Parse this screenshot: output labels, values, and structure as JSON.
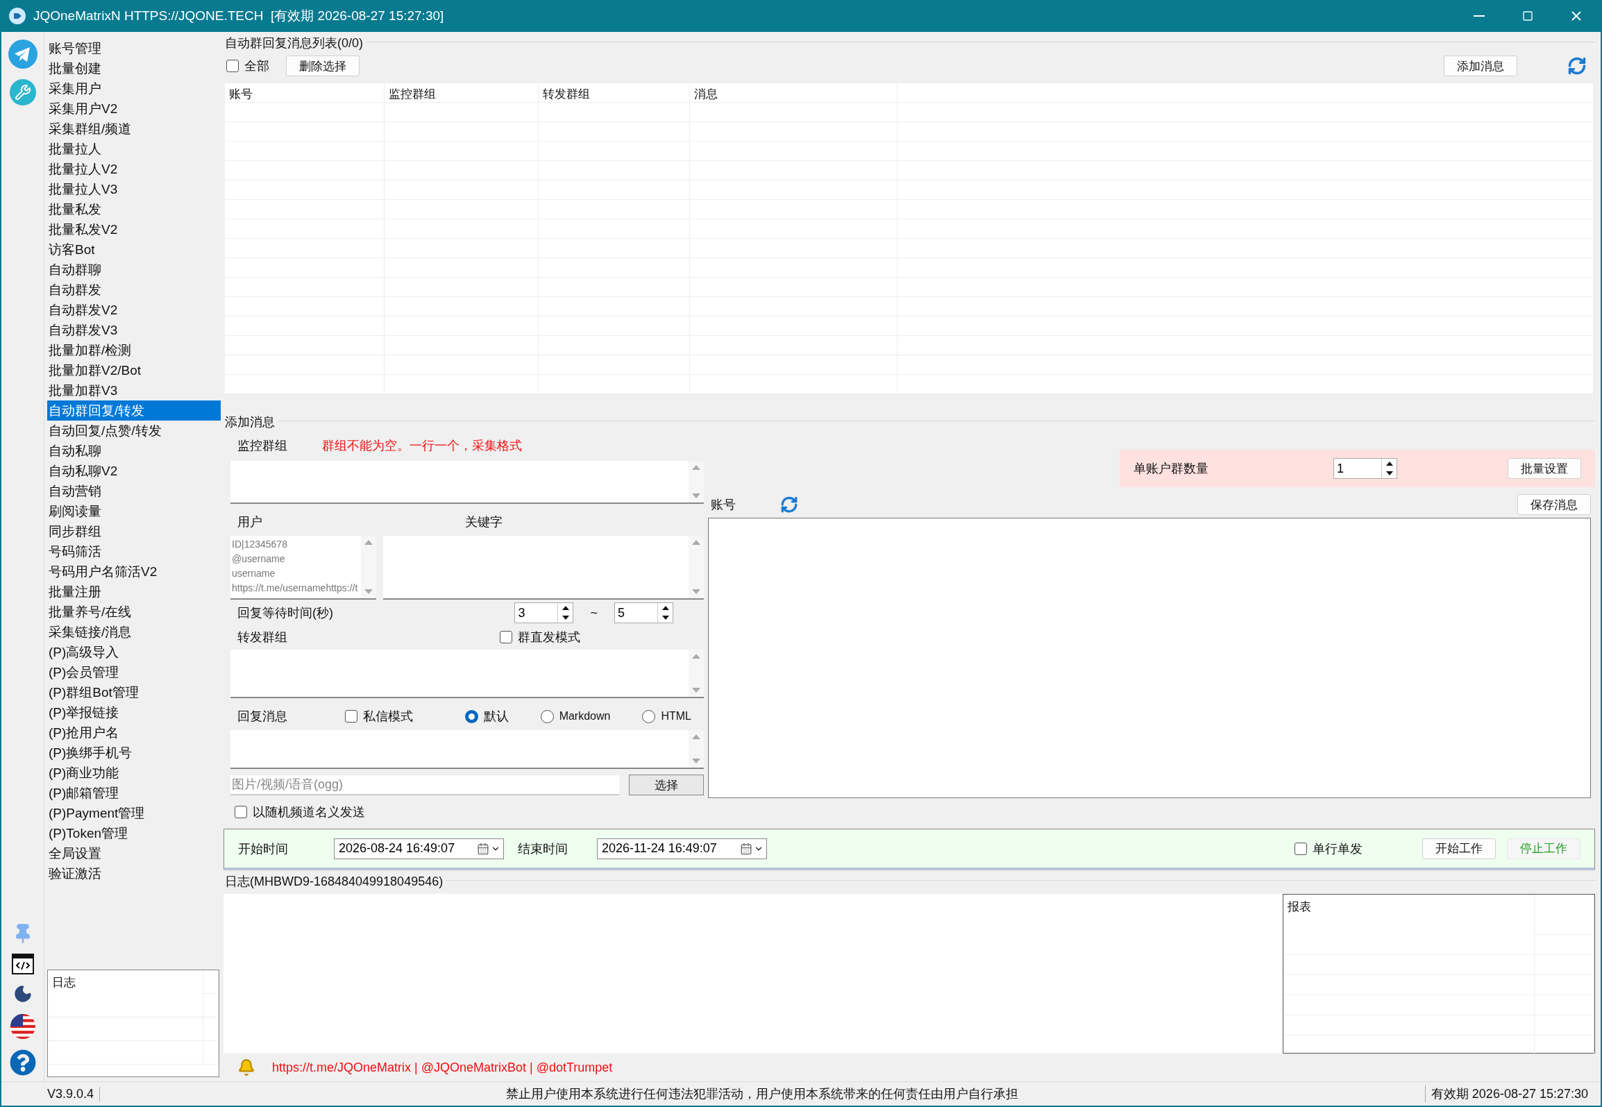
{
  "window": {
    "title": "JQOneMatrixN HTTPS://JQONE.TECH  [有效期 2026-08-27 15:27:30]"
  },
  "sidebar": {
    "items": [
      {
        "label": "账号管理",
        "selected": false
      },
      {
        "label": "批量创建",
        "selected": false
      },
      {
        "label": "采集用户",
        "selected": false
      },
      {
        "label": "采集用户V2",
        "selected": false
      },
      {
        "label": "采集群组/频道",
        "selected": false
      },
      {
        "label": "批量拉人",
        "selected": false
      },
      {
        "label": "批量拉人V2",
        "selected": false
      },
      {
        "label": "批量拉人V3",
        "selected": false
      },
      {
        "label": "批量私发",
        "selected": false
      },
      {
        "label": "批量私发V2",
        "selected": false
      },
      {
        "label": "访客Bot",
        "selected": false
      },
      {
        "label": "自动群聊",
        "selected": false
      },
      {
        "label": "自动群发",
        "selected": false
      },
      {
        "label": "自动群发V2",
        "selected": false
      },
      {
        "label": "自动群发V3",
        "selected": false
      },
      {
        "label": "批量加群/检测",
        "selected": false
      },
      {
        "label": "批量加群V2/Bot",
        "selected": false
      },
      {
        "label": "批量加群V3",
        "selected": false
      },
      {
        "label": "自动群回复/转发",
        "selected": true
      },
      {
        "label": "自动回复/点赞/转发",
        "selected": false
      },
      {
        "label": "自动私聊",
        "selected": false
      },
      {
        "label": "自动私聊V2",
        "selected": false
      },
      {
        "label": "自动营销",
        "selected": false
      },
      {
        "label": "刷阅读量",
        "selected": false
      },
      {
        "label": "同步群组",
        "selected": false
      },
      {
        "label": "号码筛活",
        "selected": false
      },
      {
        "label": "号码用户名筛活V2",
        "selected": false
      },
      {
        "label": "批量注册",
        "selected": false
      },
      {
        "label": "批量养号/在线",
        "selected": false
      },
      {
        "label": "采集链接/消息",
        "selected": false
      },
      {
        "label": "(P)高级导入",
        "selected": false
      },
      {
        "label": "(P)会员管理",
        "selected": false
      },
      {
        "label": "(P)群组Bot管理",
        "selected": false
      },
      {
        "label": "(P)举报链接",
        "selected": false
      },
      {
        "label": "(P)抢用户名",
        "selected": false
      },
      {
        "label": "(P)换绑手机号",
        "selected": false
      },
      {
        "label": "(P)商业功能",
        "selected": false
      },
      {
        "label": "(P)邮箱管理",
        "selected": false
      },
      {
        "label": "(P)Payment管理",
        "selected": false
      },
      {
        "label": "(P)Token管理",
        "selected": false
      },
      {
        "label": "全局设置",
        "selected": false
      },
      {
        "label": "验证激活",
        "selected": false
      }
    ],
    "log_header": "日志"
  },
  "message_list": {
    "title": "自动群回复消息列表(0/0)",
    "select_all": {
      "label": "全部",
      "checked": false
    },
    "delete_button": "删除选择",
    "add_button": "添加消息",
    "columns": [
      "账号",
      "监控群组",
      "转发群组",
      "消息"
    ]
  },
  "add_message": {
    "title": "添加消息",
    "monitor_label": "监控群组",
    "monitor_hint": "群组不能为空。一行一个，采集格式",
    "user_label": "用户",
    "user_placeholder": "ID|12345678\n@username\nusername\nhttps://t.me/usernamehttps://t",
    "keyword_label": "关键字",
    "wait_label": "回复等待时间(秒)",
    "wait_min": "3",
    "wait_separator": "~",
    "wait_max": "5",
    "forward_label": "转发群组",
    "direct_mode": {
      "label": "群直发模式",
      "checked": false
    },
    "reply_label": "回复消息",
    "private_mode": {
      "label": "私信模式",
      "checked": false
    },
    "formats": [
      {
        "label": "默认",
        "selected": true
      },
      {
        "label": "Markdown",
        "selected": false
      },
      {
        "label": "HTML",
        "selected": false
      }
    ],
    "media_placeholder": "图片/视频/语音(ogg)",
    "choose_button": "选择",
    "random_channel": {
      "label": "以随机频道名义发送",
      "checked": false
    }
  },
  "accounts": {
    "per_account_label": "单账户群数量",
    "per_account_value": "1",
    "batch_button": "批量设置",
    "label": "账号",
    "save_button": "保存消息"
  },
  "schedule": {
    "start_label": "开始时间",
    "start_value": "2026-08-24 16:49:07",
    "end_label": "结束时间",
    "end_value": "2026-11-24 16:49:07",
    "single": {
      "label": "单行单发",
      "checked": false
    },
    "start_button": "开始工作",
    "stop_button": "停止工作"
  },
  "log": {
    "title": "日志(MHBWD9-168484049918049546)",
    "report_header": "报表"
  },
  "links": "https://t.me/JQOneMatrix | @JQOneMatrixBot | @dotTrumpet",
  "status_bar": {
    "version": "V3.9.0.4",
    "notice": "禁止用户使用本系统进行任何违法犯罪活动，用户使用本系统带来的任何责任由用户自行承担",
    "expiry": "有效期 2026-08-27 15:27:30"
  }
}
